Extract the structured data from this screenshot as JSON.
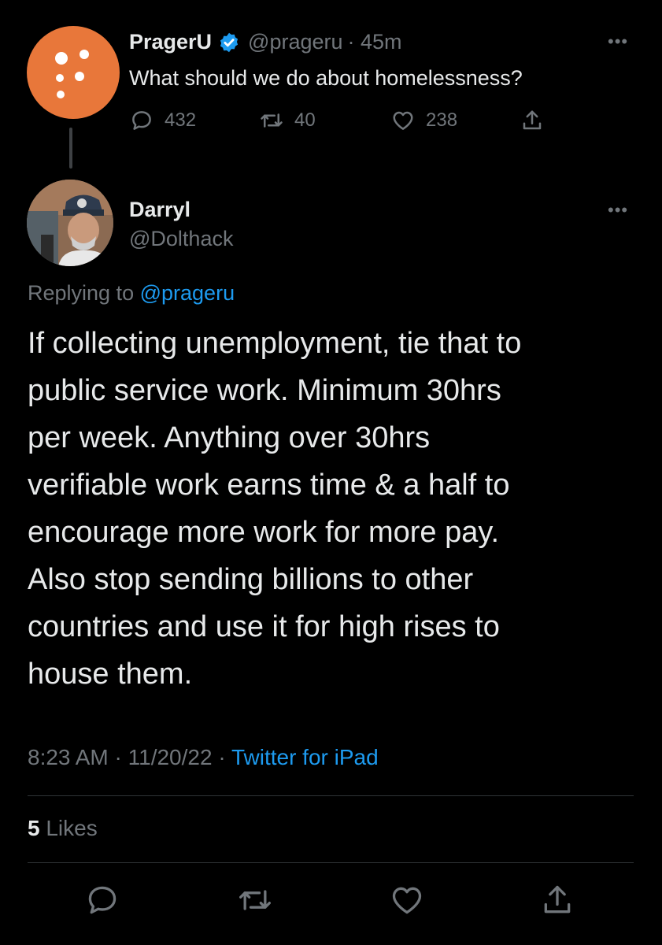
{
  "parent_tweet": {
    "name": "PragerU",
    "handle": "@prageru",
    "time": "· 45m",
    "text": "What should we do about homelessness?",
    "replies": "432",
    "retweets": "40",
    "likes": "238"
  },
  "reply_tweet": {
    "name": "Darryl",
    "handle": "@Dolthack",
    "replying_prefix": "Replying to",
    "replying_to": "@prageru",
    "text": "If collecting unemployment, tie that to\npublic service work.  Minimum 30hrs\nper week.  Anything over 30hrs\nverifiable work earns time & a half to\nencourage more work for more pay.\nAlso stop sending billions to other\ncountries and use it for high rises to\nhouse them.",
    "time": "8:23 AM",
    "date": "11/20/22",
    "source": "Twitter for iPad",
    "likes_count": "5",
    "likes_label": "Likes"
  },
  "colors": {
    "background": "#000000",
    "text": "#e7e9ea",
    "secondary": "#71767b",
    "link": "#1d9bf0",
    "prageru_orange": "#e8773a"
  }
}
